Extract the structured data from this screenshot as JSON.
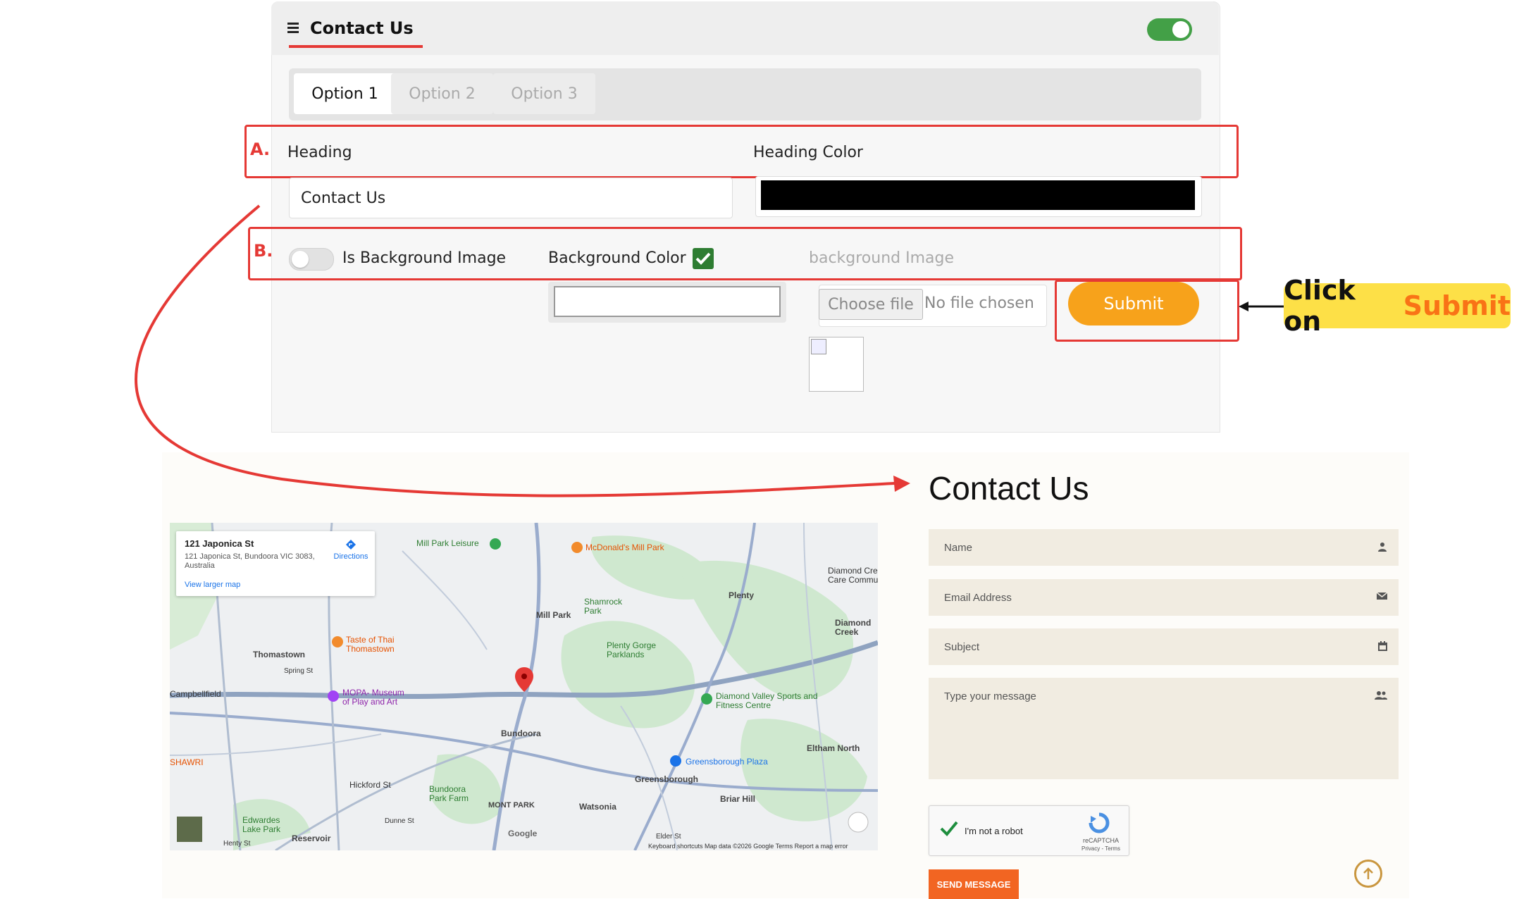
{
  "admin": {
    "section_title": "Contact Us",
    "enabled": true,
    "tabs": [
      {
        "label": "Option 1",
        "active": true
      },
      {
        "label": "Option 2",
        "active": false
      },
      {
        "label": "Option 3",
        "active": false
      }
    ],
    "marker_a": "A.",
    "marker_b": "B.",
    "heading_label": "Heading",
    "heading_value": "Contact Us",
    "heading_color_label": "Heading Color",
    "heading_color": "#000000",
    "is_bg_image_label": "Is Background Image",
    "is_bg_image": false,
    "bg_color_label": "Background Color",
    "bg_color_checked": true,
    "bg_image_label": "background Image",
    "choose_file_label": "Choose file",
    "file_status": "No file chosen",
    "submit_label": "Submit"
  },
  "callout": {
    "prefix": "Click on",
    "highlight": "Submit"
  },
  "preview": {
    "heading": "Contact Us",
    "map": {
      "place_name": "121 Japonica St",
      "place_address": "121 Japonica St, Bundoora VIC 3083, Australia",
      "directions_label": "Directions",
      "view_larger": "View larger map",
      "labels": {
        "mill_park_leisure": "Mill Park Leisure",
        "mcdonalds": "McDonald's Mill Park",
        "shamrock_park": "Shamrock Park",
        "mill_park": "Mill Park",
        "plenty": "Plenty",
        "diamond_creek": "Diamond Creek",
        "diamond_care": "Diamond Cre Care Commun",
        "thomastown": "Thomastown",
        "taste_of_thai": "Taste of Thai Thomastown",
        "plenty_gorge": "Plenty Gorge Parklands",
        "mopa": "MOPA- Museum of Play and Art",
        "campbellfield": "Campbellfield",
        "dv_sports": "Diamond Valley Sports and Fitness Centre",
        "bundoora": "Bundoora",
        "eltham_north": "Eltham North",
        "greensborough_plaza": "Greensborough Plaza",
        "greensborough": "Greensborough",
        "hickford": "Hickford St",
        "bundoora_park": "Bundoora Park Farm",
        "mont_park": "MONT PARK",
        "watsonia": "Watsonia",
        "briar_hill": "Briar Hill",
        "edwardes": "Edwardes Lake Park",
        "reservoir": "Reservoir",
        "shawri": "SHAWRI",
        "spring_st": "Spring St",
        "dunne_st": "Dunne St",
        "henty_st": "Henty St",
        "elder_st": "Elder St"
      },
      "footer": "Keyboard shortcuts   Map data ©2026 Google   Terms   Report a map error",
      "google": "Google"
    },
    "form": {
      "name_placeholder": "Name",
      "email_placeholder": "Email Address",
      "subject_placeholder": "Subject",
      "message_placeholder": "Type your message",
      "recaptcha_label": "I'm not a robot",
      "recaptcha_brand": "reCAPTCHA",
      "recaptcha_links": "Privacy - Terms",
      "send_label": "SEND MESSAGE"
    }
  },
  "colors": {
    "accent_red": "#e53935",
    "toggle_green": "#43a047",
    "submit_orange": "#f7a21b",
    "callout_yellow": "#fde047",
    "send_orange": "#f26522",
    "form_field_bg": "#f1ece1"
  }
}
